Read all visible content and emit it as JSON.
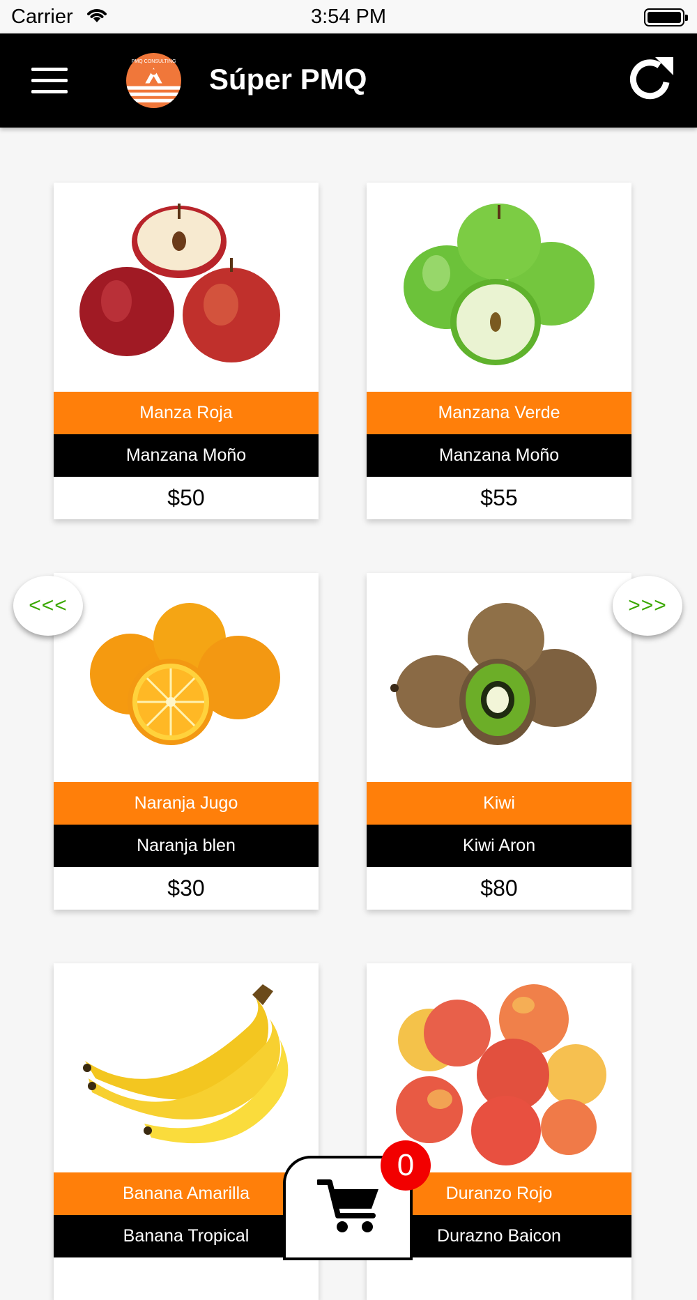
{
  "status_bar": {
    "carrier": "Carrier",
    "time": "3:54 PM"
  },
  "header": {
    "title": "Súper PMQ",
    "logo_text": "PMQ CONSULTING"
  },
  "navigation": {
    "prev_label": "<<<",
    "next_label": ">>>"
  },
  "products": [
    {
      "name": "Manza Roja",
      "variety": "Manzana Moño",
      "price": "$50",
      "image": "red-apples"
    },
    {
      "name": "Manzana Verde",
      "variety": "Manzana Moño",
      "price": "$55",
      "image": "green-apples"
    },
    {
      "name": "Naranja Jugo",
      "variety": "Naranja blen",
      "price": "$30",
      "image": "oranges"
    },
    {
      "name": "Kiwi",
      "variety": "Kiwi Aron",
      "price": "$80",
      "image": "kiwis"
    },
    {
      "name": "Banana Amarilla",
      "variety": "Banana Tropical",
      "price": "",
      "image": "bananas"
    },
    {
      "name": "Duranzo Rojo",
      "variety": "Durazno Baicon",
      "price": "",
      "image": "peaches"
    }
  ],
  "cart": {
    "count": "0"
  },
  "colors": {
    "header_bg": "#000000",
    "name_bar": "#ff7f0a",
    "variety_bar": "#000000",
    "arrow_text": "#3aa800",
    "badge": "#f20000"
  }
}
